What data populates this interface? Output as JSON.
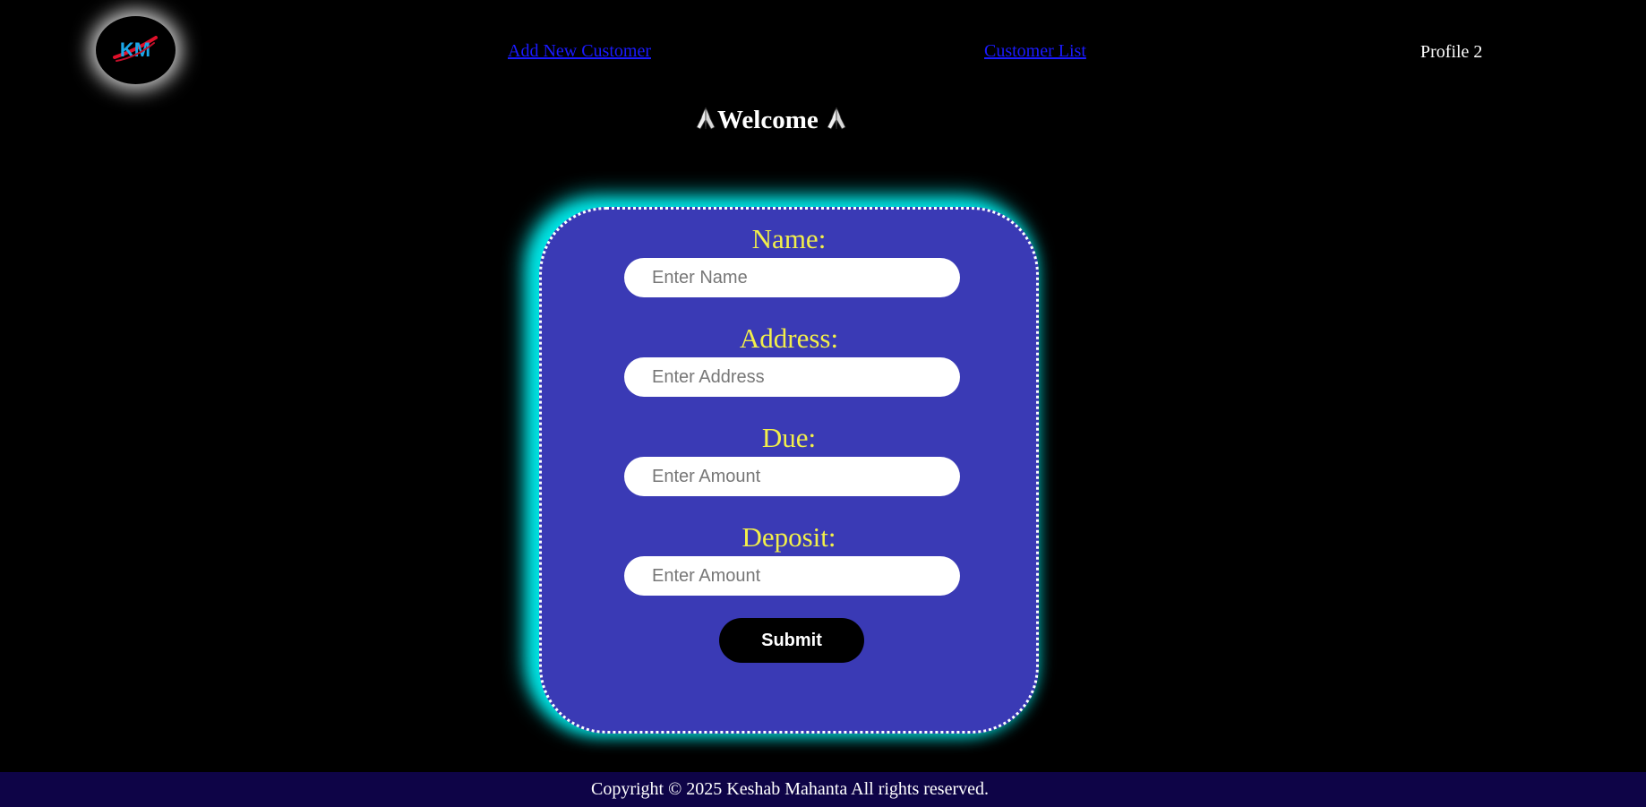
{
  "header": {
    "logo": {
      "text": "KM",
      "icon": "km-logo-icon"
    },
    "nav": {
      "add_customer": "Add New Customer",
      "customer_list": "Customer List",
      "profile": "Profile 2"
    }
  },
  "welcome": {
    "title": "Welcome",
    "icon": "folded-hands-icon"
  },
  "form": {
    "fields": [
      {
        "label": "Name:",
        "placeholder": "Enter Name",
        "value": ""
      },
      {
        "label": "Address:",
        "placeholder": "Enter Address",
        "value": ""
      },
      {
        "label": "Due:",
        "placeholder": "Enter Amount",
        "value": ""
      },
      {
        "label": "Deposit:",
        "placeholder": "Enter Amount",
        "value": ""
      }
    ],
    "submit_label": "Submit"
  },
  "footer": {
    "text": "Copyright © 2025 Keshab Mahanta All rights reserved."
  },
  "colors": {
    "background": "#000000",
    "card": "#3a3ab5",
    "card_glow": "#00e5e5",
    "label": "#f2ef4a",
    "link": "#1a1aff",
    "footer": "#0e0447"
  }
}
